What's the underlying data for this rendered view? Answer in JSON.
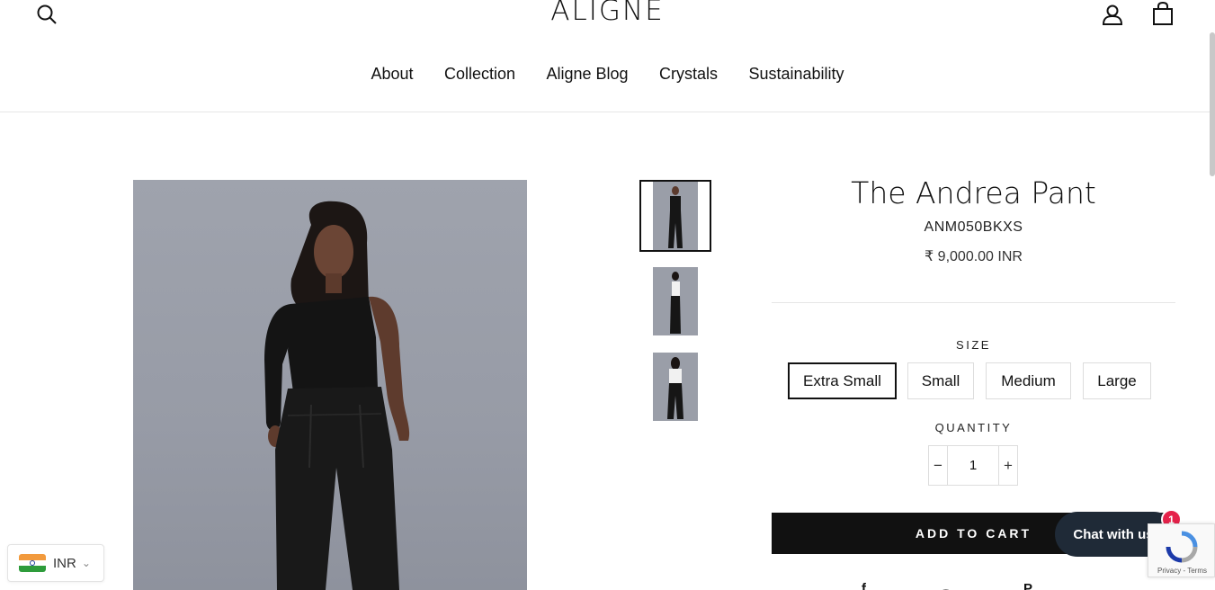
{
  "header": {
    "logo": "ALIGNE",
    "icons": {
      "search": "search-icon",
      "account": "account-icon",
      "cart": "cart-icon"
    }
  },
  "nav": {
    "items": [
      {
        "label": "About"
      },
      {
        "label": "Collection"
      },
      {
        "label": "Aligne Blog"
      },
      {
        "label": "Crystals"
      },
      {
        "label": "Sustainability"
      }
    ]
  },
  "product": {
    "title": "The Andrea Pant",
    "sku": "ANM050BKXS",
    "price": "₹ 9,000.00 INR",
    "size_label": "SIZE",
    "sizes": [
      {
        "label": "Extra Small",
        "selected": true
      },
      {
        "label": "Small",
        "selected": false
      },
      {
        "label": "Medium",
        "selected": false
      },
      {
        "label": "Large",
        "selected": false
      }
    ],
    "quantity_label": "QUANTITY",
    "quantity": "1",
    "quantity_minus": "−",
    "quantity_plus": "+",
    "add_to_cart": "ADD TO CART",
    "social": {
      "facebook": "f",
      "pinterest": "P"
    }
  },
  "currency": {
    "code": "INR",
    "flag": "india-flag-icon"
  },
  "chat": {
    "label": "Chat with us!",
    "badge": "1"
  },
  "recaptcha": {
    "terms": "Privacy - Terms"
  },
  "colors": {
    "accent": "#111111",
    "chat_bg": "#1f2a37",
    "badge": "#e5224a"
  }
}
